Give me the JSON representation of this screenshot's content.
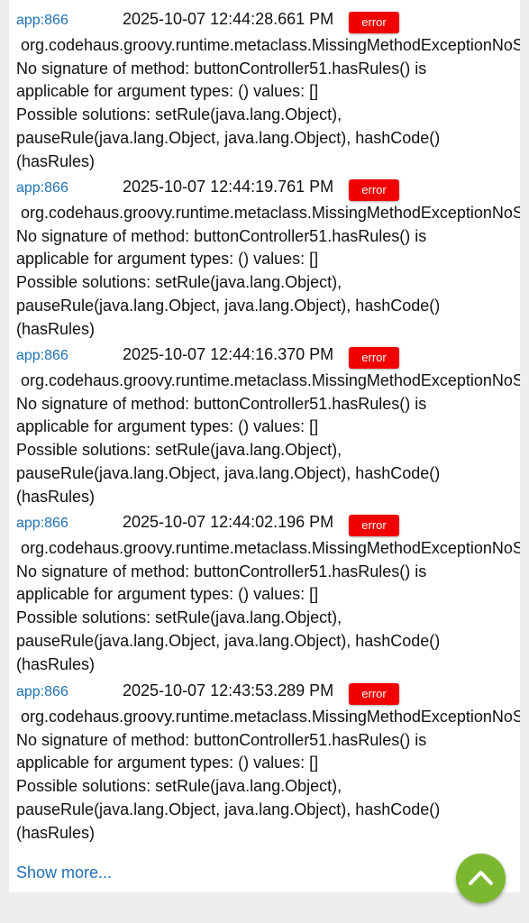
{
  "entries": [
    {
      "source": "app:866",
      "timestamp": "2025-10-07 12:44:28.661 PM",
      "level": "error",
      "lines": [
        "org.codehaus.groovy.runtime.metaclass.MissingMethodExceptionNoS",
        "No signature of method: buttonController51.hasRules() is",
        "applicable for argument types: () values: []",
        "Possible solutions: setRule(java.lang.Object),",
        "pauseRule(java.lang.Object, java.lang.Object), hashCode()",
        "(hasRules)"
      ]
    },
    {
      "source": "app:866",
      "timestamp": "2025-10-07 12:44:19.761 PM",
      "level": "error",
      "lines": [
        "org.codehaus.groovy.runtime.metaclass.MissingMethodExceptionNoS",
        "No signature of method: buttonController51.hasRules() is",
        "applicable for argument types: () values: []",
        "Possible solutions: setRule(java.lang.Object),",
        "pauseRule(java.lang.Object, java.lang.Object), hashCode()",
        "(hasRules)"
      ]
    },
    {
      "source": "app:866",
      "timestamp": "2025-10-07 12:44:16.370 PM",
      "level": "error",
      "lines": [
        "org.codehaus.groovy.runtime.metaclass.MissingMethodExceptionNoS",
        "No signature of method: buttonController51.hasRules() is",
        "applicable for argument types: () values: []",
        "Possible solutions: setRule(java.lang.Object),",
        "pauseRule(java.lang.Object, java.lang.Object), hashCode()",
        "(hasRules)"
      ]
    },
    {
      "source": "app:866",
      "timestamp": "2025-10-07 12:44:02.196 PM",
      "level": "error",
      "lines": [
        "org.codehaus.groovy.runtime.metaclass.MissingMethodExceptionNoS",
        "No signature of method: buttonController51.hasRules() is",
        "applicable for argument types: () values: []",
        "Possible solutions: setRule(java.lang.Object),",
        "pauseRule(java.lang.Object, java.lang.Object), hashCode()",
        "(hasRules)"
      ]
    },
    {
      "source": "app:866",
      "timestamp": "2025-10-07 12:43:53.289 PM",
      "level": "error",
      "lines": [
        "org.codehaus.groovy.runtime.metaclass.MissingMethodExceptionNoS",
        "No signature of method: buttonController51.hasRules() is",
        "applicable for argument types: () values: []",
        "Possible solutions: setRule(java.lang.Object),",
        "pauseRule(java.lang.Object, java.lang.Object), hashCode()",
        "(hasRules)"
      ]
    }
  ],
  "show_more_label": "Show more...",
  "scroll_top_icon": "chevron-up-icon",
  "colors": {
    "link": "#1e6fb4",
    "error_badge": "#f20000",
    "fab": "#7cb82f",
    "page_background": "#eeeeee"
  }
}
